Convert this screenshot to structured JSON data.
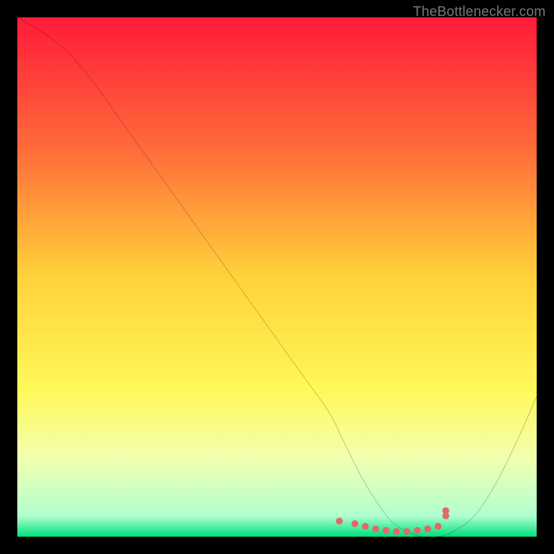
{
  "attribution": "TheBottlenecker.com",
  "chart_data": {
    "type": "line",
    "title": "",
    "xlabel": "",
    "ylabel": "",
    "xlim": [
      0,
      100
    ],
    "ylim": [
      0,
      100
    ],
    "background": "rainbow-gradient",
    "gradient_stops": [
      {
        "offset": 0,
        "color": "#ff1a3a"
      },
      {
        "offset": 25,
        "color": "#ff6a3a"
      },
      {
        "offset": 50,
        "color": "#ffd23a"
      },
      {
        "offset": 72,
        "color": "#fff95a"
      },
      {
        "offset": 85,
        "color": "#f2ffb0"
      },
      {
        "offset": 96,
        "color": "#b0ffd0"
      },
      {
        "offset": 100,
        "color": "#00e07a"
      }
    ],
    "series": [
      {
        "name": "bottleneck-curve",
        "stroke": "#000000",
        "stroke_width": 2,
        "x": [
          0,
          5,
          10,
          15,
          20,
          25,
          30,
          35,
          40,
          45,
          50,
          55,
          60,
          63,
          66,
          69,
          72,
          75,
          78,
          81,
          84,
          88,
          92,
          96,
          100
        ],
        "values": [
          100,
          97,
          93,
          87,
          80,
          73,
          66,
          59,
          52,
          45,
          38,
          31,
          24,
          18,
          12,
          7,
          3,
          1,
          0,
          0,
          1,
          4,
          10,
          18,
          27
        ]
      }
    ],
    "markers": {
      "name": "optimal-range",
      "color": "#e06a6a",
      "radius": 5,
      "x": [
        62,
        65,
        67,
        69,
        71,
        73,
        75,
        77,
        79,
        81,
        82.5,
        82.5
      ],
      "values": [
        3,
        2.5,
        2,
        1.5,
        1.2,
        1,
        1,
        1.2,
        1.5,
        2,
        4,
        5
      ]
    }
  }
}
